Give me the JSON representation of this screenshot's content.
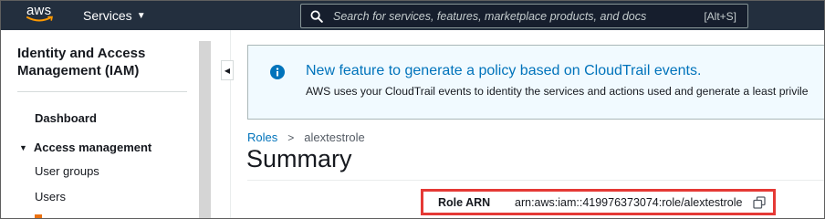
{
  "topnav": {
    "logo_text": "aws",
    "services_label": "Services",
    "search_placeholder": "Search for services, features, marketplace products, and docs",
    "search_shortcut": "[Alt+S]"
  },
  "sidebar": {
    "title": "Identity and Access Management (IAM)",
    "items": [
      {
        "label": "Dashboard"
      },
      {
        "label": "Access management"
      },
      {
        "label": "User groups"
      },
      {
        "label": "Users"
      }
    ]
  },
  "banner": {
    "title": "New feature to generate a policy based on CloudTrail events.",
    "description": "AWS uses your CloudTrail events to identity the services and actions used and generate a least privile"
  },
  "breadcrumb": {
    "root": "Roles",
    "separator": ">",
    "current": "alextestrole"
  },
  "page": {
    "title": "Summary"
  },
  "summary": {
    "role_arn_label": "Role ARN",
    "role_arn_value": "arn:aws:iam::419976373074:role/alextestrole"
  },
  "colors": {
    "nav_bg": "#232f3e",
    "link": "#0073bb",
    "highlight": "#e53935",
    "brand_orange": "#ff9900"
  }
}
